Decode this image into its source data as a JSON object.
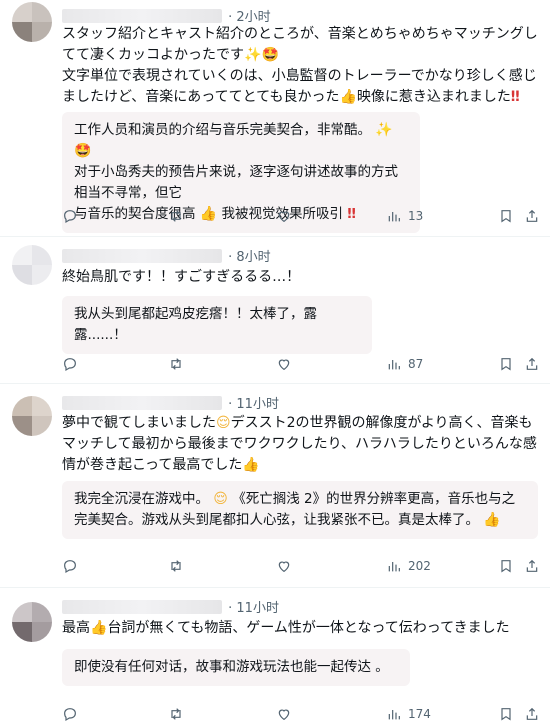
{
  "posts": [
    {
      "time": "· 2小时",
      "text_lines": [
        "スタッフ紹介とキャスト紹介のところが、音楽とめちゃめちゃマッチングし",
        "てて凄くカッコよかったです",
        "文字単位で表現されていくのは、小島監督のトレーラーでかなり珍しく感じ",
        "ましたけど、音楽にあっててとても良かった",
        "映像に惹き込まれました"
      ],
      "translation_lines": [
        "工作人员和演员的介绍与音乐完美契合，非常酷。",
        "对于小岛秀夫的预告片来说，逐字逐句讲述故事的方式相当不寻常，但它",
        "与音乐的契合度很高",
        "我被视觉效果所吸引"
      ],
      "views": "13"
    },
    {
      "time": "· 8小时",
      "text_lines": [
        "終始鳥肌です！！すごすぎるるる…！"
      ],
      "translation_lines": [
        "我从头到尾都起鸡皮疙瘩！！太棒了，露露......！"
      ],
      "views": "87"
    },
    {
      "time": "· 11小时",
      "text_lines": [
        "夢中で観てしまいました",
        "デススト2の世界観の解像度がより高く、音楽も",
        "マッチして最初から最後までワクワクしたり、ハラハラしたりといろんな感",
        "情が巻き起こって最高でした"
      ],
      "translation_lines": [
        "我完全沉浸在游戏中。",
        "《死亡搁浅 2》的世界分辨率更高，音乐也与之",
        "完美契合。游戏从头到尾都扣人心弦，让我紧张不已。真是太棒了。"
      ],
      "views": "202"
    },
    {
      "time": "· 11小时",
      "text_lines": [
        "最高",
        "台詞が無くても物語、ゲーム性が一体となって伝わってきました"
      ],
      "translation_lines": [
        "即使没有任何对话，故事和游戏玩法也能一起传达 。"
      ],
      "views": "174"
    }
  ],
  "icons": {
    "reply": "reply-icon",
    "repost": "repost-icon",
    "like": "like-icon",
    "views": "views-icon",
    "bookmark": "bookmark-icon",
    "share": "share-icon"
  },
  "colors": {
    "accent": "#1d9bf0",
    "muted": "#536471",
    "translation_bg": "#f7f3f4"
  }
}
